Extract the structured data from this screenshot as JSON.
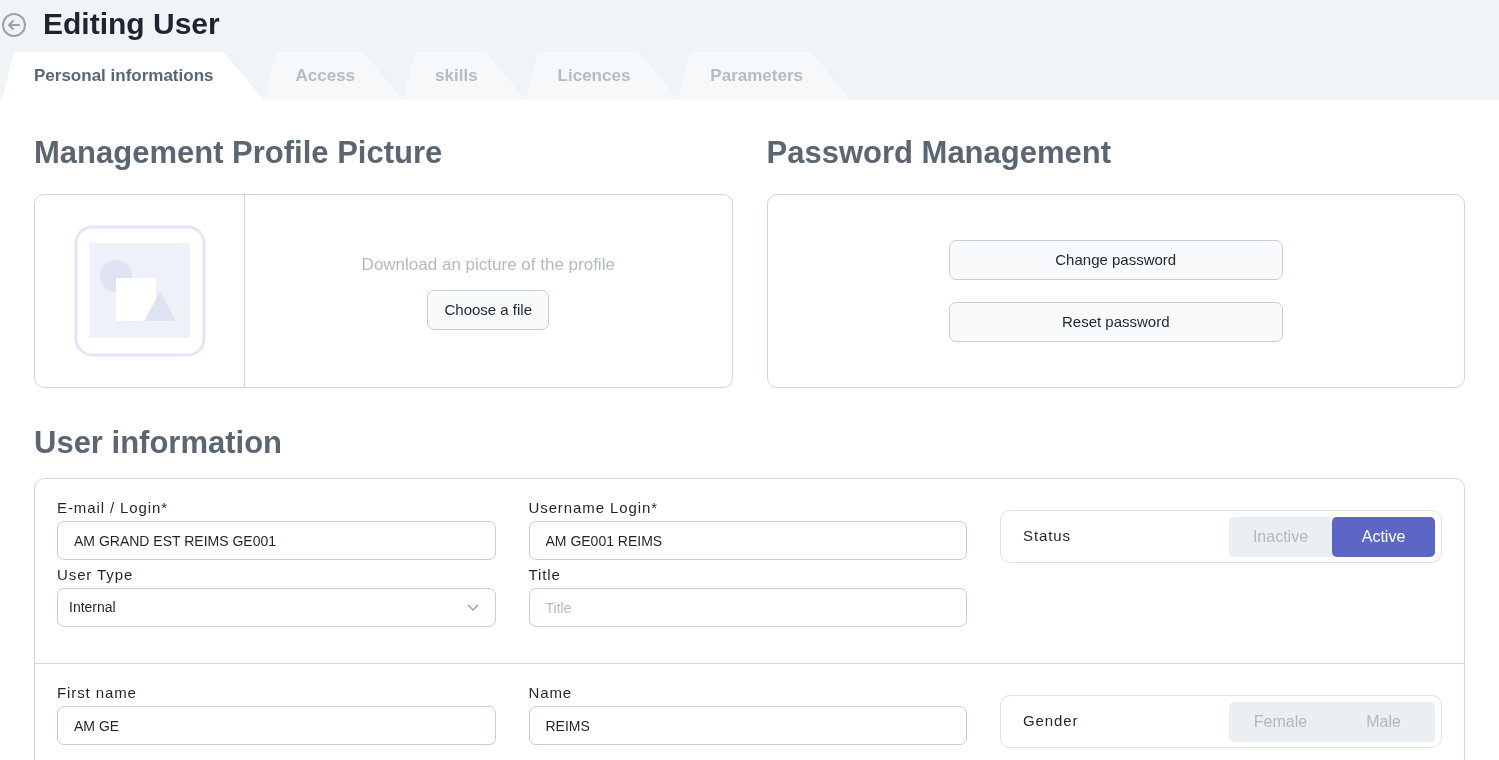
{
  "page": {
    "title": "Editing User"
  },
  "tabs": [
    {
      "label": "Personal informations",
      "selected": true
    },
    {
      "label": "Access",
      "selected": false
    },
    {
      "label": "skills",
      "selected": false
    },
    {
      "label": "Licences",
      "selected": false
    },
    {
      "label": "Parameters",
      "selected": false
    }
  ],
  "profile_picture": {
    "heading": "Management Profile Picture",
    "hint": "Download an picture of the profile",
    "button": "Choose a file"
  },
  "password": {
    "heading": "Password Management",
    "buttons": [
      "Change password",
      "Reset password"
    ]
  },
  "user_information": {
    "heading": "User information",
    "sections": [
      {
        "fields": [
          {
            "kind": "input",
            "label": "E-mail / Login*",
            "value": "AM GRAND EST REIMS GE001"
          },
          {
            "kind": "input",
            "label": "Username Login*",
            "value": "AM GE001 REIMS"
          },
          {
            "kind": "select",
            "label": "User Type",
            "value": "Internal"
          },
          {
            "kind": "input",
            "label": "Title",
            "placeholder": "Title"
          }
        ],
        "toggle": {
          "label": "Status",
          "options": [
            {
              "label": "Inactive",
              "selected": false
            },
            {
              "label": "Active",
              "selected": true
            }
          ]
        }
      },
      {
        "fields": [
          {
            "kind": "input",
            "label": "First name",
            "value": "AM GE"
          },
          {
            "kind": "input",
            "label": "Name",
            "value": "REIMS"
          }
        ],
        "toggle": {
          "label": "Gender",
          "options": [
            {
              "label": "Female",
              "selected": false
            },
            {
              "label": "Male",
              "selected": false
            }
          ]
        }
      }
    ]
  }
}
